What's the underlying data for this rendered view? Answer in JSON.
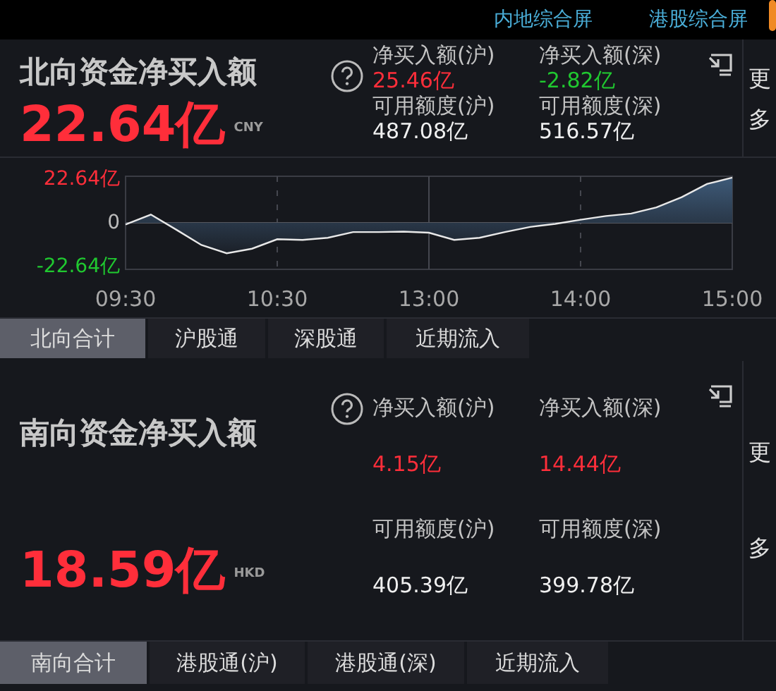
{
  "top_links": [
    {
      "label": "内地综合屏"
    },
    {
      "label": "港股综合屏"
    }
  ],
  "panels": [
    {
      "title": "北向资金净买入额",
      "value": "22.64亿",
      "currency": "CNY",
      "more": "更多",
      "kind": "compact",
      "stats": [
        {
          "label": "净买入额(沪)",
          "value": "25.46亿",
          "color": "#ff2e3a"
        },
        {
          "label": "净买入额(深)",
          "value": "-2.82亿",
          "color": "#20c830"
        },
        {
          "label": "可用额度(沪)",
          "value": "487.08亿",
          "color": "#f0f0f0"
        },
        {
          "label": "可用额度(深)",
          "value": "516.57亿",
          "color": "#f0f0f0"
        }
      ],
      "chart_data": {
        "type": "area",
        "categories": [
          "09:30",
          null,
          null,
          null,
          null,
          null,
          "10:30",
          null,
          null,
          null,
          null,
          null,
          "13:00",
          null,
          null,
          null,
          null,
          null,
          "14:00",
          null,
          null,
          null,
          null,
          null,
          "15:00"
        ],
        "series": [
          {
            "color": "#e8e8e8",
            "values": [
              -0.8,
              4.0,
              -3.3,
              -10.8,
              -14.8,
              -12.6,
              -8.0,
              -8.3,
              -7.3,
              -4.5,
              -4.5,
              -4.3,
              -4.8,
              -8.3,
              -7.3,
              -4.5,
              -2.0,
              -0.5,
              1.5,
              3.3,
              4.5,
              7.5,
              12.5,
              18.9,
              22
            ]
          }
        ],
        "ylim": [
          -22.64,
          22.64
        ],
        "yticks": [
          {
            "value": 22.64,
            "label": "22.64亿"
          },
          {
            "value": 0,
            "label": "0"
          },
          {
            "value": -22.64,
            "label": "-22.64亿"
          }
        ]
      },
      "tabs": [
        {
          "label": "北向合计",
          "selected": true
        },
        {
          "label": "沪股通",
          "selected": false
        },
        {
          "label": "深股通",
          "selected": false
        },
        {
          "label": "近期流入",
          "selected": false
        }
      ]
    },
    {
      "title": "南向资金净买入额",
      "value": "18.59亿",
      "currency": "HKD",
      "more": "更多",
      "kind": "spread",
      "stats": [
        {
          "label": "净买入额(沪)",
          "value": "4.15亿",
          "color": "#ff2e3a"
        },
        {
          "label": "净买入额(深)",
          "value": "14.44亿",
          "color": "#ff2e3a"
        },
        {
          "label": "可用额度(沪)",
          "value": "405.39亿",
          "color": "#f0f0f0"
        },
        {
          "label": "可用额度(深)",
          "value": "399.78亿",
          "color": "#f0f0f0"
        }
      ],
      "tabs": [
        {
          "label": "南向合计",
          "selected": true
        },
        {
          "label": "港股通(沪)",
          "selected": false
        },
        {
          "label": "港股通(深)",
          "selected": false
        },
        {
          "label": "近期流入",
          "selected": false
        }
      ]
    }
  ]
}
